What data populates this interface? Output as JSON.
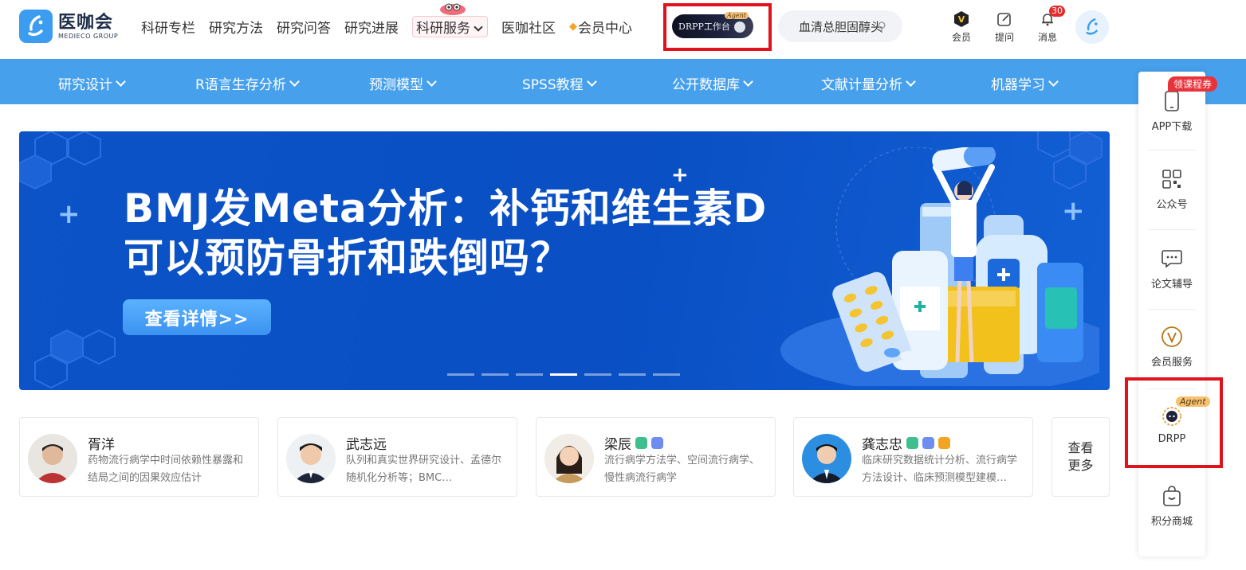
{
  "brand": {
    "name_cn": "医咖会",
    "name_en": "MEDIECO GROUP"
  },
  "topnav": [
    {
      "label": "科研专栏"
    },
    {
      "label": "研究方法"
    },
    {
      "label": "研究问答"
    },
    {
      "label": "研究进展"
    },
    {
      "label": "科研服务"
    },
    {
      "label": "医咖社区"
    },
    {
      "label": "会员中心"
    }
  ],
  "drpp_button": {
    "label": "DRPP工作台",
    "badge": "Agent"
  },
  "search": {
    "value": "血清总胆固醇头"
  },
  "tools": {
    "vip_label": "会员",
    "ask_label": "提问",
    "msg_label": "消息",
    "msg_count": "30",
    "vip_glyph": "V"
  },
  "subnav": [
    {
      "label": "研究设计"
    },
    {
      "label": "R语言生存分析"
    },
    {
      "label": "预测模型"
    },
    {
      "label": "SPSS教程"
    },
    {
      "label": "公开数据库"
    },
    {
      "label": "文献计量分析"
    },
    {
      "label": "机器学习"
    }
  ],
  "banner": {
    "line1": "BMJ发Meta分析：补钙和维生素D",
    "line2": "可以预防骨折和跌倒吗？",
    "cta": "查看详情>>",
    "slide_count": 7,
    "active_slide": 4
  },
  "experts": [
    {
      "name": "胥洋",
      "desc": "药物流行病学中时间依赖性暴露和结局之间的因果效应估计",
      "tags": []
    },
    {
      "name": "武志远",
      "desc": "队列和真实世界研究设计、孟德尔随机化分析等；BMC…",
      "tags": []
    },
    {
      "name": "梁辰",
      "desc": "流行病学方法学、空间流行病学、慢性病流行病学",
      "tags": [
        "#3fbf8f",
        "#6f8cf0"
      ]
    },
    {
      "name": "龚志忠",
      "desc": "临床研究数据统计分析、流行病学方法设计、临床预测模型建模…",
      "tags": [
        "#3fbf8f",
        "#6f8cf0",
        "#f3a423"
      ]
    }
  ],
  "more_experts": {
    "line1": "查看",
    "line2": "更多"
  },
  "sidebar": {
    "coupon": "领课程券",
    "items": [
      {
        "label": "APP下载",
        "icon": "phone-icon"
      },
      {
        "label": "公众号",
        "icon": "qrcode-icon"
      },
      {
        "label": "论文辅导",
        "icon": "chat-icon"
      },
      {
        "label": "会员服务",
        "icon": "vip-icon"
      },
      {
        "label": "DRPP",
        "icon": "drpp-icon",
        "badge": "Agent"
      },
      {
        "label": "积分商城",
        "icon": "shopping-bag-icon"
      }
    ]
  },
  "colors": {
    "primary": "#47a0ec",
    "banner": "#0b53c7",
    "highlight": "#e0121b",
    "coupon": "#e8333a"
  }
}
